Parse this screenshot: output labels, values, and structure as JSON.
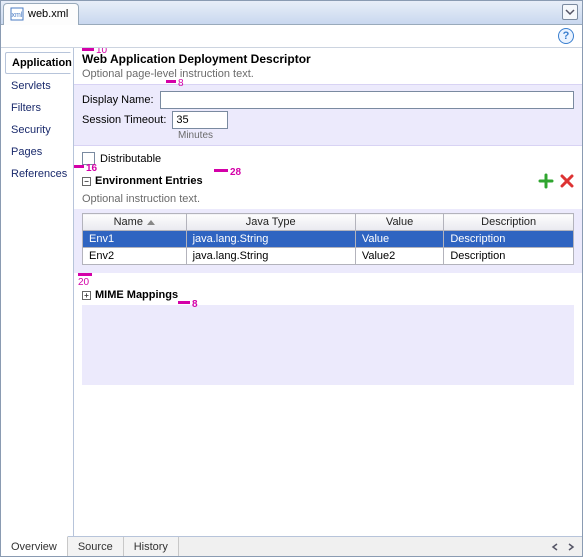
{
  "titlebar": {
    "tab_label": "web.xml"
  },
  "side_tabs": {
    "items": [
      {
        "label": "Application"
      },
      {
        "label": "Servlets"
      },
      {
        "label": "Filters"
      },
      {
        "label": "Security"
      },
      {
        "label": "Pages"
      },
      {
        "label": "References"
      }
    ],
    "active_index": 0
  },
  "main": {
    "heading": "Web Application Deployment Descriptor",
    "subtext": "Optional page-level instruction text.",
    "display_name_label": "Display Name:",
    "display_name_value": "",
    "session_timeout_label": "Session Timeout:",
    "session_timeout_value": "35",
    "session_timeout_unit": "Minutes",
    "distributable_label": "Distributable",
    "distributable_checked": false
  },
  "annotations": {
    "top_gap": "10",
    "under_display": "8",
    "left_of_timeout": "8",
    "right_of_display": "8",
    "env_left": "16",
    "env_after": "28",
    "after_table": "20",
    "mime_after": "8"
  },
  "env": {
    "title": "Environment Entries",
    "subtext": "Optional instruction text.",
    "columns": [
      "Name",
      "Java Type",
      "Value",
      "Description"
    ],
    "sort_col": 0,
    "rows": [
      {
        "cells": [
          "Env1",
          "java.lang.String",
          "Value",
          "Description"
        ],
        "selected": true
      },
      {
        "cells": [
          "Env2",
          "java.lang.String",
          "Value2",
          "Description"
        ],
        "selected": false
      }
    ]
  },
  "mime": {
    "title": "MIME Mappings"
  },
  "bottom_tabs": {
    "items": [
      {
        "label": "Overview"
      },
      {
        "label": "Source"
      },
      {
        "label": "History"
      }
    ],
    "active_index": 0
  }
}
